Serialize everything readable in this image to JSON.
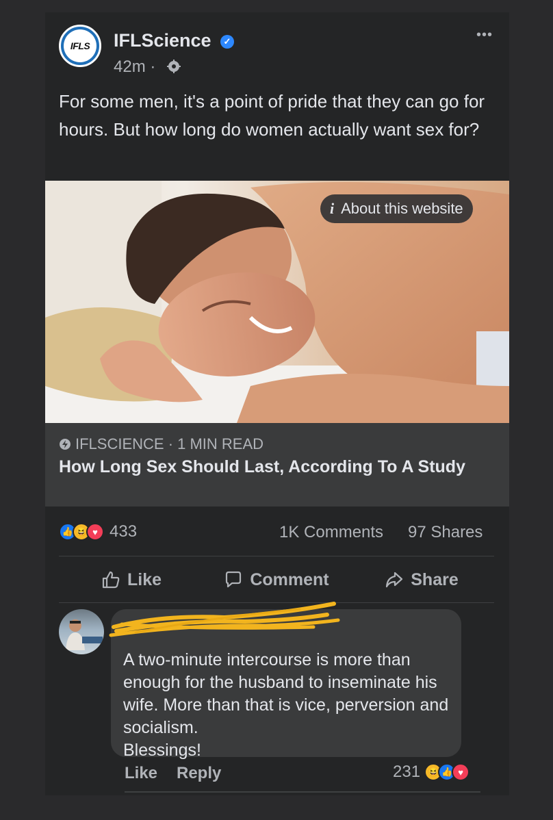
{
  "post": {
    "page_name": "IFLScience",
    "avatar_text": "IFLS",
    "time": "42m ·",
    "more": "•••",
    "text": "For some men, it's a point of pride that they can go for hours. But how long do women actually want sex for?"
  },
  "link": {
    "about_label": "About this website",
    "domain": "IFLSCIENCE · 1 MIN READ",
    "title": "How Long Sex Should Last, According To A Study"
  },
  "stats": {
    "reactions_count": "433",
    "reaction_icons": [
      "like-icon",
      "haha-icon",
      "love-icon"
    ],
    "comments": "1K Comments",
    "shares": "97 Shares"
  },
  "actions": {
    "like": "Like",
    "comment": "Comment",
    "share": "Share"
  },
  "comment": {
    "text": "A two-minute intercourse is more than enough for the husband to inseminate his wife. More than that is vice, perversion and socialism.\nBlessings!",
    "like": "Like",
    "reply": "Reply",
    "reactions_count": "231",
    "reaction_icons": [
      "haha-icon",
      "like-icon",
      "love-icon"
    ]
  },
  "colors": {
    "background": "#242526",
    "accent": "#2d88ff",
    "redaction": "#f2b41e"
  }
}
